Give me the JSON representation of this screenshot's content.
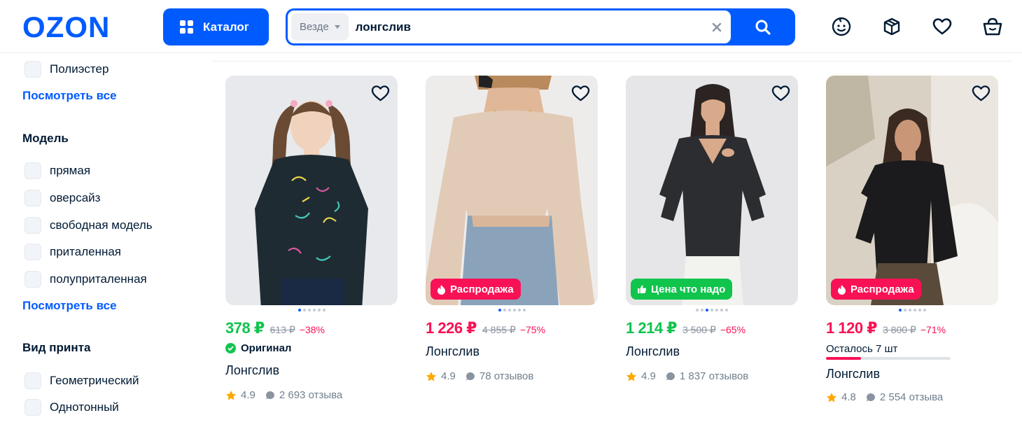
{
  "header": {
    "logo_text": "OZON",
    "catalog_label": "Каталог",
    "search": {
      "scope_label": "Везде",
      "query": "лонгслив"
    },
    "icons": [
      "emoji-smile-icon",
      "package-box-icon",
      "heart-icon",
      "shopping-bag-icon"
    ]
  },
  "colors": {
    "brand_blue": "#005bff",
    "price_green": "#10c44c",
    "price_red": "#f91155",
    "sale_badge": "#f91155",
    "good_price_badge": "#10c44c",
    "star": "#ffa800"
  },
  "sidebar": {
    "material_items": [
      {
        "label": "Полиэстер"
      }
    ],
    "material_see_all": "Посмотреть все",
    "model_title": "Модель",
    "model_items": [
      {
        "label": "прямая"
      },
      {
        "label": "оверсайз"
      },
      {
        "label": "свободная модель"
      },
      {
        "label": "приталенная"
      },
      {
        "label": "полуприталенная"
      }
    ],
    "model_see_all": "Посмотреть все",
    "print_title": "Вид принта",
    "print_items": [
      {
        "label": "Геометрический"
      },
      {
        "label": "Однотонный"
      }
    ]
  },
  "products": [
    {
      "price": "378 ₽",
      "old_price": "613 ₽",
      "discount": "−38%",
      "original_label": "Оригинал",
      "title": "Лонгслив",
      "rating": "4.9",
      "reviews": "2 693 отзыва",
      "active_dot": 0,
      "dots": 6
    },
    {
      "price": "1 226 ₽",
      "old_price": "4 855 ₽",
      "discount": "−75%",
      "badge": "Распродажа",
      "title": "Лонгслив",
      "rating": "4.9",
      "reviews": "78 отзывов",
      "active_dot": 0,
      "dots": 6
    },
    {
      "price": "1 214 ₽",
      "old_price": "3 500 ₽",
      "discount": "−65%",
      "badge": "Цена что надо",
      "title": "Лонгслив",
      "rating": "4.9",
      "reviews": "1 837 отзывов",
      "active_dot": 2,
      "dots": 7
    },
    {
      "price": "1 120 ₽",
      "old_price": "3 800 ₽",
      "discount": "−71%",
      "badge": "Распродажа",
      "stock_label": "Осталось 7 шт",
      "stock_fraction": 0.28,
      "title": "Лонгслив",
      "rating": "4.8",
      "reviews": "2 554 отзыва",
      "active_dot": 0,
      "dots": 6
    }
  ]
}
